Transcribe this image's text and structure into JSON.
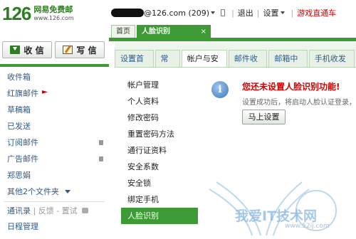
{
  "brand": {
    "number": "126",
    "name": "网易免费邮",
    "url": "www.126.com"
  },
  "userbar": {
    "email": "@126.com (209)",
    "logout": "退出",
    "settings": "设置",
    "game": "游戏直通车"
  },
  "top_tabs": [
    {
      "label": "首页"
    },
    {
      "label": "人脸识别",
      "close": "×"
    }
  ],
  "compose": {
    "receive": "收 信",
    "write": "写 信"
  },
  "folders": [
    {
      "label": "收件箱"
    },
    {
      "label": "红旗邮件"
    },
    {
      "label": "草稿箱"
    },
    {
      "label": "已发送"
    },
    {
      "label": "订阅邮件"
    },
    {
      "label": "广告邮件"
    },
    {
      "label": "郑思娟"
    },
    {
      "label": "其他2个文件夹"
    }
  ],
  "contacts": {
    "book": "通讯录",
    "sep": "|",
    "feedback": "反馈 - 置试"
  },
  "schedule": "日程管理",
  "sub_tabs": [
    {
      "label": "设置首页"
    },
    {
      "label": "常规"
    },
    {
      "label": "帐户与安全"
    },
    {
      "label": "邮件收发"
    },
    {
      "label": "邮箱中心"
    },
    {
      "label": "手机收发邮"
    }
  ],
  "menu": [
    {
      "label": "帐户管理"
    },
    {
      "label": "个人资料"
    },
    {
      "label": "修改密码"
    },
    {
      "label": "重置密码方法"
    },
    {
      "label": "通行证资料"
    },
    {
      "label": "安全系数"
    },
    {
      "label": "安全锁"
    },
    {
      "label": "绑定手机"
    },
    {
      "label": "人脸识别"
    }
  ],
  "notice": {
    "icon": "i",
    "title": "您还未设置人脸识别功能!",
    "desc": "设置成功后，将启动人脸认证登录，",
    "button": "马上设置"
  },
  "watermark": {
    "text": "我爱IT技术网",
    "url": "www.52ij.com"
  },
  "colors": {
    "brand_green": "#3e9a35",
    "alert_red": "#d40000",
    "link_blue": "#2f5a8c"
  }
}
